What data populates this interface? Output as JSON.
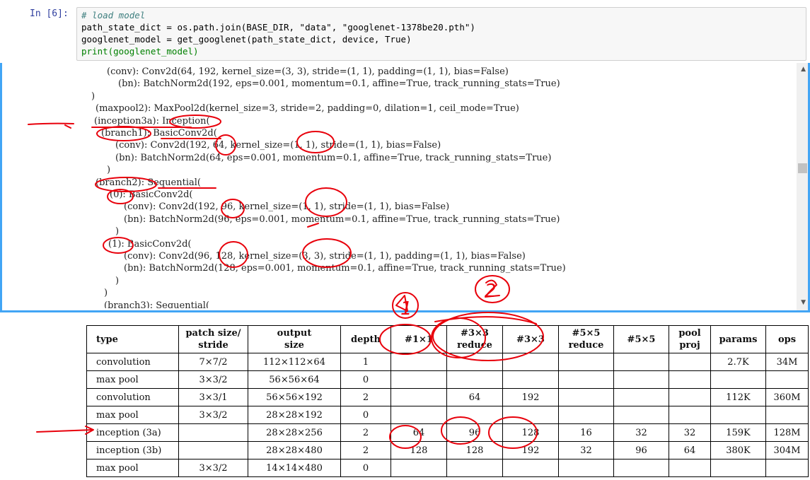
{
  "cell": {
    "prompt": "In  [6]:",
    "code_lines": [
      "# load model",
      "path_state_dict = os.path.join(BASE_DIR, \"data\", \"googlenet-1378be20.pth\")",
      "googlenet_model = get_googlenet(path_state_dict, device, True)",
      "print(googlenet_model)"
    ]
  },
  "output": {
    "lines": [
      "    (conv): Conv2d(64, 192, kernel_size=(3, 3), stride=(1, 1), padding=(1, 1), bias=False)",
      "    (bn): BatchNorm2d(192, eps=0.001, momentum=0.1, affine=True, track_running_stats=True)",
      "  )",
      "  (maxpool2): MaxPool2d(kernel_size=3, stride=2, padding=0, dilation=1, ceil_mode=True)",
      "  (inception3a): Inception(",
      "    (branch1): BasicConv2d(",
      "      (conv): Conv2d(192, 64, kernel_size=(1, 1), stride=(1, 1), bias=False)",
      "      (bn): BatchNorm2d(64, eps=0.001, momentum=0.1, affine=True, track_running_stats=True)",
      "    )",
      "    (branch2): Sequential(",
      "      (0): BasicConv2d(",
      "        (conv): Conv2d(192, 96, kernel_size=(1, 1), stride=(1, 1), bias=False)",
      "        (bn): BatchNorm2d(96, eps=0.001, momentum=0.1, affine=True, track_running_stats=True)",
      "      )",
      "      (1): BasicConv2d(",
      "        (conv): Conv2d(96, 128, kernel_size=(3, 3), stride=(1, 1), padding=(1, 1), bias=False)",
      "        (bn): BatchNorm2d(128, eps=0.001, momentum=0.1, affine=True, track_running_stats=True)",
      "      )",
      "    )",
      "    (branch3): Sequential("
    ]
  },
  "table": {
    "headers": [
      "type",
      "patch size/\nstride",
      "output\nsize",
      "depth",
      "#1×1",
      "#3×3\nreduce",
      "#3×3",
      "#5×5\nreduce",
      "#5×5",
      "pool\nproj",
      "params",
      "ops"
    ],
    "rows": [
      [
        "convolution",
        "7×7/2",
        "112×112×64",
        "1",
        "",
        "",
        "",
        "",
        "",
        "",
        "2.7K",
        "34M"
      ],
      [
        "max pool",
        "3×3/2",
        "56×56×64",
        "0",
        "",
        "",
        "",
        "",
        "",
        "",
        "",
        ""
      ],
      [
        "convolution",
        "3×3/1",
        "56×56×192",
        "2",
        "",
        "64",
        "192",
        "",
        "",
        "",
        "112K",
        "360M"
      ],
      [
        "max pool",
        "3×3/2",
        "28×28×192",
        "0",
        "",
        "",
        "",
        "",
        "",
        "",
        "",
        ""
      ],
      [
        "inception (3a)",
        "",
        "28×28×256",
        "2",
        "64",
        "96",
        "128",
        "16",
        "32",
        "32",
        "159K",
        "128M"
      ],
      [
        "inception (3b)",
        "",
        "28×28×480",
        "2",
        "128",
        "128",
        "192",
        "32",
        "96",
        "64",
        "380K",
        "304M"
      ],
      [
        "max pool",
        "3×3/2",
        "14×14×480",
        "0",
        "",
        "",
        "",
        "",
        "",
        "",
        "",
        ""
      ]
    ]
  },
  "annotations": {
    "label_1": "1",
    "label_2": "2",
    "ink_color": "#e8000b"
  }
}
